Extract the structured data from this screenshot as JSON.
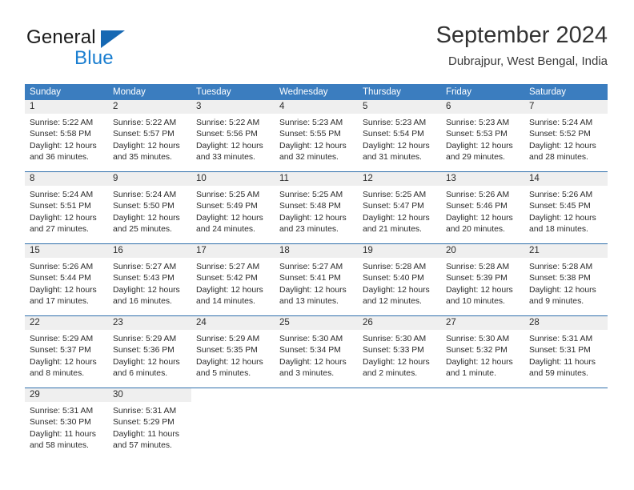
{
  "brand": {
    "word1": "General",
    "word2": "Blue",
    "triangle_color": "#1668b3",
    "blue_text_color": "#1a7ed0"
  },
  "header": {
    "title": "September 2024",
    "subtitle": "Dubrajpur, West Bengal, India"
  },
  "theme": {
    "header_row_bg": "#3b7dbf",
    "week_divider": "#2f6fab",
    "daynum_band_bg": "#efefef",
    "text": "#2b2b2b"
  },
  "weekdays": [
    "Sunday",
    "Monday",
    "Tuesday",
    "Wednesday",
    "Thursday",
    "Friday",
    "Saturday"
  ],
  "weeks": [
    [
      {
        "day": "1",
        "sunrise": "Sunrise: 5:22 AM",
        "sunset": "Sunset: 5:58 PM",
        "daylight1": "Daylight: 12 hours",
        "daylight2": "and 36 minutes."
      },
      {
        "day": "2",
        "sunrise": "Sunrise: 5:22 AM",
        "sunset": "Sunset: 5:57 PM",
        "daylight1": "Daylight: 12 hours",
        "daylight2": "and 35 minutes."
      },
      {
        "day": "3",
        "sunrise": "Sunrise: 5:22 AM",
        "sunset": "Sunset: 5:56 PM",
        "daylight1": "Daylight: 12 hours",
        "daylight2": "and 33 minutes."
      },
      {
        "day": "4",
        "sunrise": "Sunrise: 5:23 AM",
        "sunset": "Sunset: 5:55 PM",
        "daylight1": "Daylight: 12 hours",
        "daylight2": "and 32 minutes."
      },
      {
        "day": "5",
        "sunrise": "Sunrise: 5:23 AM",
        "sunset": "Sunset: 5:54 PM",
        "daylight1": "Daylight: 12 hours",
        "daylight2": "and 31 minutes."
      },
      {
        "day": "6",
        "sunrise": "Sunrise: 5:23 AM",
        "sunset": "Sunset: 5:53 PM",
        "daylight1": "Daylight: 12 hours",
        "daylight2": "and 29 minutes."
      },
      {
        "day": "7",
        "sunrise": "Sunrise: 5:24 AM",
        "sunset": "Sunset: 5:52 PM",
        "daylight1": "Daylight: 12 hours",
        "daylight2": "and 28 minutes."
      }
    ],
    [
      {
        "day": "8",
        "sunrise": "Sunrise: 5:24 AM",
        "sunset": "Sunset: 5:51 PM",
        "daylight1": "Daylight: 12 hours",
        "daylight2": "and 27 minutes."
      },
      {
        "day": "9",
        "sunrise": "Sunrise: 5:24 AM",
        "sunset": "Sunset: 5:50 PM",
        "daylight1": "Daylight: 12 hours",
        "daylight2": "and 25 minutes."
      },
      {
        "day": "10",
        "sunrise": "Sunrise: 5:25 AM",
        "sunset": "Sunset: 5:49 PM",
        "daylight1": "Daylight: 12 hours",
        "daylight2": "and 24 minutes."
      },
      {
        "day": "11",
        "sunrise": "Sunrise: 5:25 AM",
        "sunset": "Sunset: 5:48 PM",
        "daylight1": "Daylight: 12 hours",
        "daylight2": "and 23 minutes."
      },
      {
        "day": "12",
        "sunrise": "Sunrise: 5:25 AM",
        "sunset": "Sunset: 5:47 PM",
        "daylight1": "Daylight: 12 hours",
        "daylight2": "and 21 minutes."
      },
      {
        "day": "13",
        "sunrise": "Sunrise: 5:26 AM",
        "sunset": "Sunset: 5:46 PM",
        "daylight1": "Daylight: 12 hours",
        "daylight2": "and 20 minutes."
      },
      {
        "day": "14",
        "sunrise": "Sunrise: 5:26 AM",
        "sunset": "Sunset: 5:45 PM",
        "daylight1": "Daylight: 12 hours",
        "daylight2": "and 18 minutes."
      }
    ],
    [
      {
        "day": "15",
        "sunrise": "Sunrise: 5:26 AM",
        "sunset": "Sunset: 5:44 PM",
        "daylight1": "Daylight: 12 hours",
        "daylight2": "and 17 minutes."
      },
      {
        "day": "16",
        "sunrise": "Sunrise: 5:27 AM",
        "sunset": "Sunset: 5:43 PM",
        "daylight1": "Daylight: 12 hours",
        "daylight2": "and 16 minutes."
      },
      {
        "day": "17",
        "sunrise": "Sunrise: 5:27 AM",
        "sunset": "Sunset: 5:42 PM",
        "daylight1": "Daylight: 12 hours",
        "daylight2": "and 14 minutes."
      },
      {
        "day": "18",
        "sunrise": "Sunrise: 5:27 AM",
        "sunset": "Sunset: 5:41 PM",
        "daylight1": "Daylight: 12 hours",
        "daylight2": "and 13 minutes."
      },
      {
        "day": "19",
        "sunrise": "Sunrise: 5:28 AM",
        "sunset": "Sunset: 5:40 PM",
        "daylight1": "Daylight: 12 hours",
        "daylight2": "and 12 minutes."
      },
      {
        "day": "20",
        "sunrise": "Sunrise: 5:28 AM",
        "sunset": "Sunset: 5:39 PM",
        "daylight1": "Daylight: 12 hours",
        "daylight2": "and 10 minutes."
      },
      {
        "day": "21",
        "sunrise": "Sunrise: 5:28 AM",
        "sunset": "Sunset: 5:38 PM",
        "daylight1": "Daylight: 12 hours",
        "daylight2": "and 9 minutes."
      }
    ],
    [
      {
        "day": "22",
        "sunrise": "Sunrise: 5:29 AM",
        "sunset": "Sunset: 5:37 PM",
        "daylight1": "Daylight: 12 hours",
        "daylight2": "and 8 minutes."
      },
      {
        "day": "23",
        "sunrise": "Sunrise: 5:29 AM",
        "sunset": "Sunset: 5:36 PM",
        "daylight1": "Daylight: 12 hours",
        "daylight2": "and 6 minutes."
      },
      {
        "day": "24",
        "sunrise": "Sunrise: 5:29 AM",
        "sunset": "Sunset: 5:35 PM",
        "daylight1": "Daylight: 12 hours",
        "daylight2": "and 5 minutes."
      },
      {
        "day": "25",
        "sunrise": "Sunrise: 5:30 AM",
        "sunset": "Sunset: 5:34 PM",
        "daylight1": "Daylight: 12 hours",
        "daylight2": "and 3 minutes."
      },
      {
        "day": "26",
        "sunrise": "Sunrise: 5:30 AM",
        "sunset": "Sunset: 5:33 PM",
        "daylight1": "Daylight: 12 hours",
        "daylight2": "and 2 minutes."
      },
      {
        "day": "27",
        "sunrise": "Sunrise: 5:30 AM",
        "sunset": "Sunset: 5:32 PM",
        "daylight1": "Daylight: 12 hours",
        "daylight2": "and 1 minute."
      },
      {
        "day": "28",
        "sunrise": "Sunrise: 5:31 AM",
        "sunset": "Sunset: 5:31 PM",
        "daylight1": "Daylight: 11 hours",
        "daylight2": "and 59 minutes."
      }
    ],
    [
      {
        "day": "29",
        "sunrise": "Sunrise: 5:31 AM",
        "sunset": "Sunset: 5:30 PM",
        "daylight1": "Daylight: 11 hours",
        "daylight2": "and 58 minutes."
      },
      {
        "day": "30",
        "sunrise": "Sunrise: 5:31 AM",
        "sunset": "Sunset: 5:29 PM",
        "daylight1": "Daylight: 11 hours",
        "daylight2": "and 57 minutes."
      },
      {
        "day": "",
        "sunrise": "",
        "sunset": "",
        "daylight1": "",
        "daylight2": ""
      },
      {
        "day": "",
        "sunrise": "",
        "sunset": "",
        "daylight1": "",
        "daylight2": ""
      },
      {
        "day": "",
        "sunrise": "",
        "sunset": "",
        "daylight1": "",
        "daylight2": ""
      },
      {
        "day": "",
        "sunrise": "",
        "sunset": "",
        "daylight1": "",
        "daylight2": ""
      },
      {
        "day": "",
        "sunrise": "",
        "sunset": "",
        "daylight1": "",
        "daylight2": ""
      }
    ]
  ]
}
